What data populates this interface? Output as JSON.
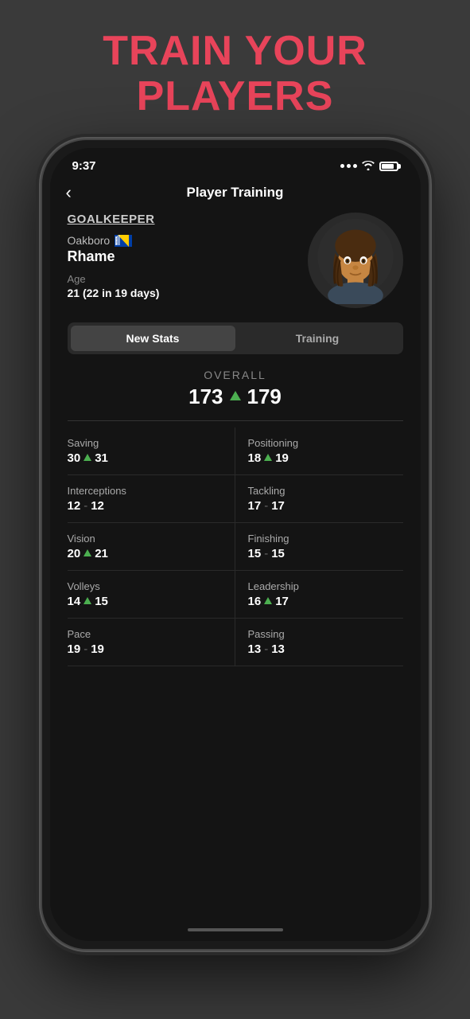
{
  "headline": {
    "line1": "TRAIN YOUR",
    "line2": "PLAYERS"
  },
  "status_bar": {
    "time": "9:37",
    "battery_label": "battery"
  },
  "header": {
    "title": "Player Training",
    "back_label": "‹"
  },
  "player": {
    "position": "GOALKEEPER",
    "club": "Oakboro",
    "name": "Rhame",
    "age_label": "Age",
    "age_value": "21 (22 in 19 days)"
  },
  "tabs": {
    "new_stats": "New Stats",
    "training": "Training"
  },
  "overall": {
    "label": "OVERALL",
    "old_value": "173",
    "new_value": "179"
  },
  "stats": [
    {
      "name": "Saving",
      "old": "30",
      "new": "31",
      "changed": true
    },
    {
      "name": "Positioning",
      "old": "18",
      "new": "19",
      "changed": true
    },
    {
      "name": "Interceptions",
      "old": "12",
      "new": "12",
      "changed": false
    },
    {
      "name": "Tackling",
      "old": "17",
      "new": "17",
      "changed": false
    },
    {
      "name": "Vision",
      "old": "20",
      "new": "21",
      "changed": true
    },
    {
      "name": "Finishing",
      "old": "15",
      "new": "15",
      "changed": false
    },
    {
      "name": "Volleys",
      "old": "14",
      "new": "15",
      "changed": true
    },
    {
      "name": "Leadership",
      "old": "16",
      "new": "17",
      "changed": true
    },
    {
      "name": "Pace",
      "old": "19",
      "new": "19",
      "changed": false
    },
    {
      "name": "Passing",
      "old": "13",
      "new": "13",
      "changed": false
    }
  ]
}
